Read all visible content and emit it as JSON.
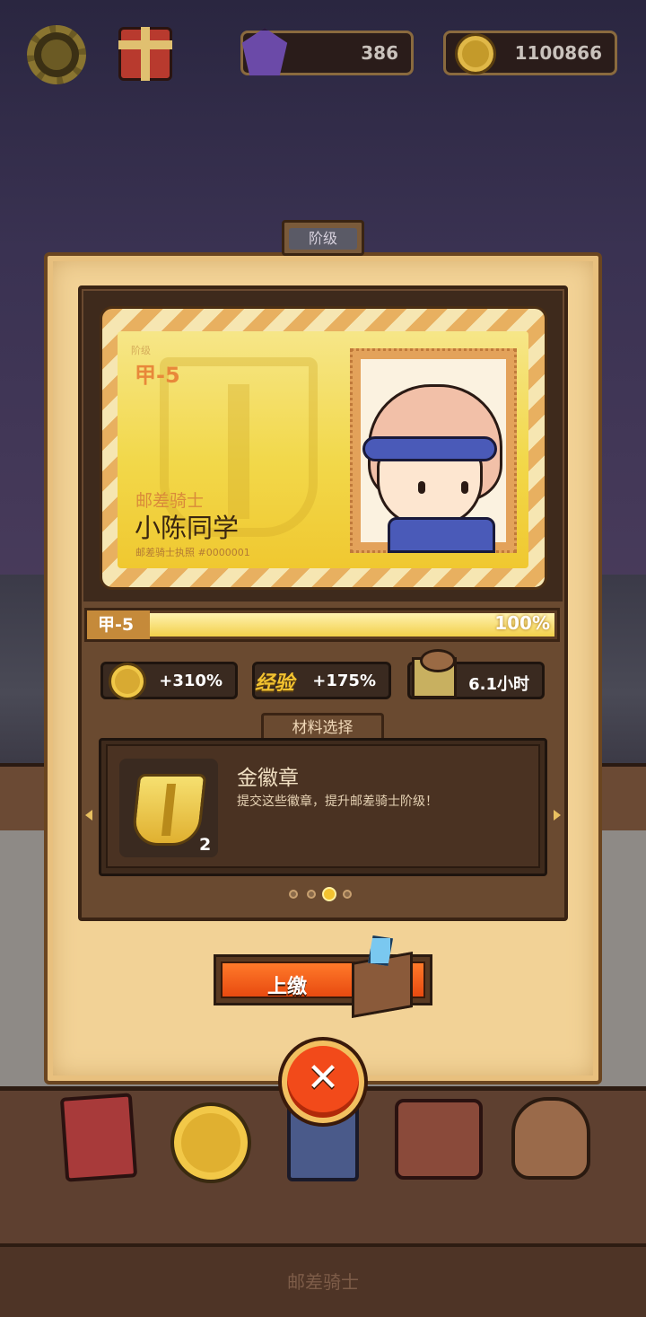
{
  "hud": {
    "gems": "386",
    "coins": "1100866",
    "icons": [
      "settings-gear-icon",
      "gift-box-icon",
      "gem-icon",
      "coin-icon"
    ]
  },
  "dialog": {
    "tab_title": "阶级"
  },
  "license_card": {
    "rank_caption": "阶级",
    "rank": "甲-5",
    "role": "邮差骑士",
    "player_name": "小陈同学",
    "license_number": "邮差骑士执照 #0000001"
  },
  "progress": {
    "rank": "甲-5",
    "percent_text": "100%",
    "percent": 100
  },
  "stats": {
    "coin_bonus": "+310%",
    "exp_label": "经验",
    "exp_bonus": "+175%",
    "time": "6.1小时"
  },
  "materials": {
    "tab_label": "材料选择",
    "item_name": "金徽章",
    "item_desc": "提交这些徽章，提升邮差骑士阶级！",
    "item_count": "2",
    "page_count": 4,
    "active_page": 2
  },
  "actions": {
    "submit_label": "上缴"
  },
  "bottom": {
    "title": "邮差骑士"
  },
  "colors": {
    "accent_orange": "#e84a10",
    "gold": "#f2c230",
    "panel_brown": "#6a4a30",
    "parchment": "#f2d296"
  }
}
